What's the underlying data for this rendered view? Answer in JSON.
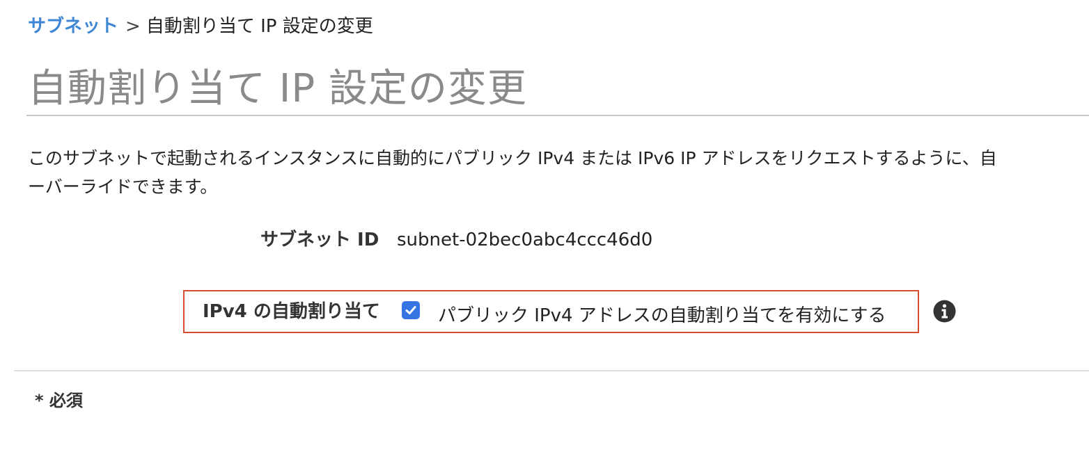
{
  "breadcrumb": {
    "parent_label": "サブネット",
    "separator": ">",
    "current_label": "自動割り当て IP 設定の変更"
  },
  "page": {
    "title": "自動割り当て IP 設定の変更",
    "description_line1": "このサブネットで起動されるインスタンスに自動的にパブリック IPv4 または IPv6 IP アドレスをリクエストするように、自",
    "description_line2": "ーバーライドできます。"
  },
  "subnet": {
    "id_label": "サブネット ID",
    "id_value": "subnet-02bec0abc4ccc46d0"
  },
  "auto_assign": {
    "label": "IPv4 の自動割り当て",
    "checkbox_checked": true,
    "checkbox_text": "パブリック IPv4 アドレスの自動割り当てを有効にする",
    "info_icon": "info-circle-icon"
  },
  "footer": {
    "required_note": "* 必須"
  },
  "colors": {
    "link": "#3f86d4",
    "checkbox": "#3574e2",
    "highlight_border": "#d94b32",
    "title": "#8a8a8a"
  }
}
